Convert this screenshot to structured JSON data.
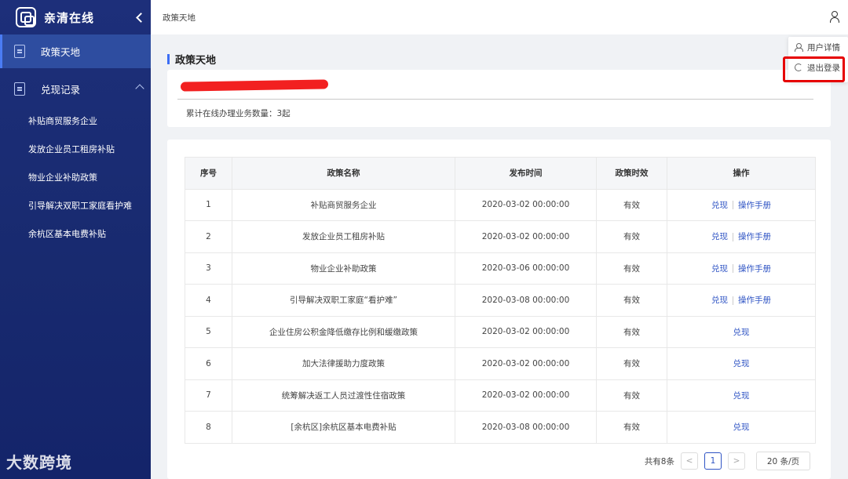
{
  "app": {
    "name": "亲清在线"
  },
  "sidebar": {
    "active_item": {
      "label": "政策天地"
    },
    "group": {
      "label": "兑现记录"
    },
    "sub_items": [
      {
        "label": "补贴商贸服务企业"
      },
      {
        "label": "发放企业员工租房补贴"
      },
      {
        "label": "物业企业补助政策"
      },
      {
        "label": "引导解决双职工家庭看护难"
      },
      {
        "label": "余杭区基本电费补贴"
      }
    ]
  },
  "header": {
    "breadcrumb": "政策天地"
  },
  "user_menu": {
    "items": [
      {
        "label": "用户详情"
      },
      {
        "label": "退出登录"
      }
    ]
  },
  "page": {
    "title": "政策天地",
    "business_count_text": "累计在线办理业务数量：3起"
  },
  "table": {
    "headers": [
      "序号",
      "政策名称",
      "发布时间",
      "政策时效",
      "操作"
    ],
    "rows": [
      {
        "no": "1",
        "name": "补贴商贸服务企业",
        "time": "2020-03-02 00:00:00",
        "status": "有效",
        "actions": [
          "兑现",
          "操作手册"
        ]
      },
      {
        "no": "2",
        "name": "发放企业员工租房补贴",
        "time": "2020-03-02 00:00:00",
        "status": "有效",
        "actions": [
          "兑现",
          "操作手册"
        ]
      },
      {
        "no": "3",
        "name": "物业企业补助政策",
        "time": "2020-03-06 00:00:00",
        "status": "有效",
        "actions": [
          "兑现",
          "操作手册"
        ]
      },
      {
        "no": "4",
        "name": "引导解决双职工家庭“看护难”",
        "time": "2020-03-08 00:00:00",
        "status": "有效",
        "actions": [
          "兑现",
          "操作手册"
        ]
      },
      {
        "no": "5",
        "name": "企业住房公积金降低缴存比例和缓缴政策",
        "time": "2020-03-02 00:00:00",
        "status": "有效",
        "actions": [
          "兑现"
        ]
      },
      {
        "no": "6",
        "name": "加大法律援助力度政策",
        "time": "2020-03-02 00:00:00",
        "status": "有效",
        "actions": [
          "兑现"
        ]
      },
      {
        "no": "7",
        "name": "统筹解决返工人员过渡性住宿政策",
        "time": "2020-03-02 00:00:00",
        "status": "有效",
        "actions": [
          "兑现"
        ]
      },
      {
        "no": "8",
        "name": "[余杭区]余杭区基本电费补贴",
        "time": "2020-03-08 00:00:00",
        "status": "有效",
        "actions": [
          "兑现"
        ]
      }
    ]
  },
  "pagination": {
    "total_text": "共有8条",
    "current_page": "1",
    "page_size": "20 条/页",
    "prev": "<",
    "next": ">"
  },
  "watermark": "大数跨境",
  "colors": {
    "sidebar": "#1d2f7a",
    "accent": "#3c6ef5",
    "link": "#2f54c4",
    "highlight": "#e60000"
  }
}
